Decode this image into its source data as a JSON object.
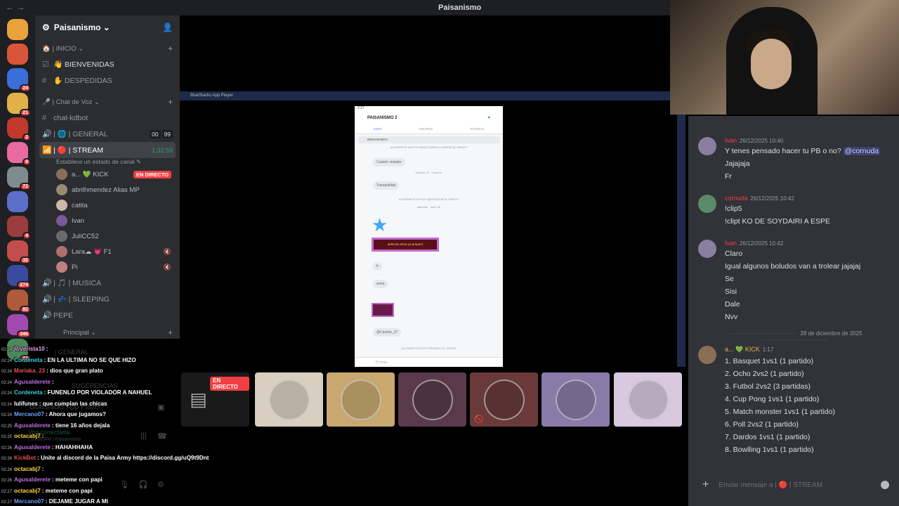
{
  "titlebar": {
    "back": "←",
    "forward": "→",
    "title": "Paisanismo"
  },
  "server_list": [
    {
      "color": "#e8a33c",
      "badge": ""
    },
    {
      "color": "#d9553a",
      "badge": ""
    },
    {
      "color": "#3a6ed9",
      "badge": "24"
    },
    {
      "color": "#e0b14a",
      "badge": "21"
    },
    {
      "color": "#c0392b",
      "badge": "2"
    },
    {
      "color": "#e86aa0",
      "badge": "9"
    },
    {
      "color": "#7f8c8d",
      "badge": "72"
    },
    {
      "color": "#5d6ec9",
      "badge": ""
    },
    {
      "color": "#9b3d3d",
      "badge": "4"
    },
    {
      "color": "#c44d4d",
      "badge": "32"
    },
    {
      "color": "#3b4a9e",
      "badge": "274"
    },
    {
      "color": "#b05a3a",
      "badge": "82"
    },
    {
      "color": "#a04ab0",
      "badge": "346"
    },
    {
      "color": "#4a8a5a",
      "badge": "25"
    }
  ],
  "server": {
    "name": "Paisanismo ⌄"
  },
  "categories": {
    "inicio": "| INICIO ⌄",
    "voz": "| Chat de Voz ⌄",
    "principal": "Principal ⌄"
  },
  "channels": {
    "bienvenidas": "BIENVENIDAS",
    "despedidas": "DESPEDIDAS",
    "chat_kdbot": "chat-kdbot",
    "general": "| 🌐 | GENERAL",
    "general_counts": [
      "00",
      "99"
    ],
    "stream": "| 🔴 | STREAM",
    "stream_time": "1:32:59",
    "stream_status": "Establece un estado de canal ✎",
    "musica": "| 🎵 | MUSICA",
    "sleeping": "| 💤 | SLEEPING",
    "pepe": "PEPE"
  },
  "members": [
    {
      "name": "a... 💚 KICK",
      "live": "EN DIRECTO",
      "color": "#8a6f55"
    },
    {
      "name": "abrilhmendez Alias MP",
      "live": "",
      "color": "#9a8a70"
    },
    {
      "name": "catita",
      "live": "",
      "color": "#d0b8a8"
    },
    {
      "name": "Ivan",
      "live": "",
      "color": "#7a5a9a"
    },
    {
      "name": "JuliCC52",
      "live": "",
      "color": "#6a6a6a"
    },
    {
      "name": "Lara☁ 💗 F1",
      "live": "",
      "color": "#b07070",
      "muted": true
    },
    {
      "name": "Pi",
      "live": "",
      "color": "#c08080",
      "muted": true
    }
  ],
  "bluestacks": {
    "title": "BlueStacks App Player"
  },
  "phone": {
    "status_time": "2:27",
    "header": "PAISANISMO 2",
    "tabs": [
      "CHAT",
      "GRUPOS",
      "PÁGINAS"
    ],
    "search": "BIENVENIDO!",
    "messages": [
      {
        "kind": "sys",
        "text": "ALEDERETE INVITÓ PAISA CORRAL A UNIRSE AL GRUPO"
      },
      {
        "kind": "bub",
        "text": "Castelo violador"
      },
      {
        "kind": "sys",
        "text": "Castelo_37 · hace 4h"
      },
      {
        "kind": "bub",
        "text": "Tranquilidad"
      },
      {
        "kind": "sys",
        "text": "ALEDERETE INVITÓ ASENTADOR AL GRUPO"
      },
      {
        "kind": "sys",
        "text": "aldeente · hace 4h"
      },
      {
        "kind": "bub",
        "text": "fr"
      },
      {
        "kind": "bub",
        "text": "arma"
      },
      {
        "kind": "bub",
        "text": "@Castelo_37"
      },
      {
        "kind": "sys",
        "text": "ALEDERETE INVITÓ PAISADO AL GRUPO"
      }
    ],
    "gif_text": "alderete arma ya preparó",
    "input": "Di hola..."
  },
  "chat": {
    "messages": [
      {
        "user": "Ivan",
        "time": "26/12/2025 10:40",
        "lines": [
          "Y tenes pensado hacer tu PB o no? @cornuda",
          "Jajajaja",
          "Fr"
        ],
        "avatar": "#8a7fa0"
      },
      {
        "user": "cornuda",
        "time": "26/12/2025 10:42",
        "lines": [
          "!clip5",
          "!clipt KO DE SOYDAIRI A ESPE"
        ],
        "avatar": "#5a8a6a"
      },
      {
        "user": "Ivan",
        "time": "26/12/2025 10:42",
        "lines": [
          "Claro",
          "Igual algunos boludos van a trolear jajajaj",
          "Se",
          "Sisi",
          "Dale",
          "Nvv"
        ],
        "avatar": "#8a7fa0"
      }
    ],
    "mention": "@cornuda",
    "date_divider": "28 de diciembre de 2025",
    "last": {
      "user": "a... 💚 KICK",
      "time": "1:17",
      "lines": [
        "1. Basquet 1vs1 (1 partido)",
        "2. Ocho 2vs2 (1 partido)",
        "3. Futbol 2vs2 (3 partidas)",
        "4. Cup Pong 1vs1 (1 partido)",
        "5. Match monster 1vs1 (1 partido)",
        "6. Poll 2vs2 (1 partido)",
        "7. Dardos 1vs1 (1 partido)",
        "8. Bowlling 1vs1 (1 partido)"
      ]
    },
    "input_placeholder": "Enviar mensaje a | 🔴 | STREAM"
  },
  "tiles": {
    "live_label": "EN DIRECTO",
    "colors": [
      "#2a2a2a",
      "#d8cfc0",
      "#c8a870",
      "#5a3a4a",
      "#6a3a3a",
      "#8a7aa8",
      "#d8c8e0"
    ]
  },
  "overlay_chat": [
    {
      "ts": "02:24",
      "user": "Riverista10",
      "color": "#e8a0e8",
      "text": ":"
    },
    {
      "ts": "02:24",
      "user": "Cordeneta",
      "color": "#3ad0e0",
      "text": ": EN LA ULTIMA NO SE QUE HIZO"
    },
    {
      "ts": "02:24",
      "user": "Mariaka_23",
      "color": "#e05050",
      "text": ": dios que gran plato"
    },
    {
      "ts": "02:24",
      "user": "Agusalderete",
      "color": "#c070e0",
      "text": ":"
    },
    {
      "ts": "02:24",
      "user": "Cordeneta",
      "color": "#3ad0e0",
      "text": ": FUNENLO POR VIOLADOR A NAHUEL"
    },
    {
      "ts": "02:24",
      "user": "lulifunes",
      "color": "#ffffff",
      "text": ": que cumplan las chicas"
    },
    {
      "ts": "02:24",
      "user": "Mercano07",
      "color": "#6aa0ff",
      "text": ": Ahora que jugamos?"
    },
    {
      "ts": "02:25",
      "user": "Agusalderete",
      "color": "#c070e0",
      "text": ": tiene 16 años dejala"
    },
    {
      "ts": "02:25",
      "user": "octacabj7",
      "color": "#ffd84a",
      "text": ":"
    },
    {
      "ts": "02:26",
      "user": "Agusalderete",
      "color": "#c070e0",
      "text": ": HAHAHHAHA"
    },
    {
      "ts": "02:26",
      "user": "KickBot",
      "color": "#e05050",
      "text": ": Unite al discord de la Paisa Army https://discord.gg/uQ9t9Dnt"
    },
    {
      "ts": "02:26",
      "user": "octacabj7",
      "color": "#ffd84a",
      "text": ":"
    },
    {
      "ts": "02:26",
      "user": "Agusalderete",
      "color": "#c070e0",
      "text": ": meteme con papi"
    },
    {
      "ts": "02:27",
      "user": "octacabj7",
      "color": "#ffd84a",
      "text": ": meteme con papi"
    },
    {
      "ts": "02:27",
      "user": "Mercano07",
      "color": "#6aa0ff",
      "text": ": DEJAME JUGAR A MI"
    }
  ],
  "ghost_ui": {
    "general": "| GENERAL",
    "bluestacks": "BlueStacks App Player",
    "voz_conectada": "Voz conectada",
    "stream_path": "| STREAM / Paisanismo",
    "sugerencias": "SUGERENCIAS"
  }
}
